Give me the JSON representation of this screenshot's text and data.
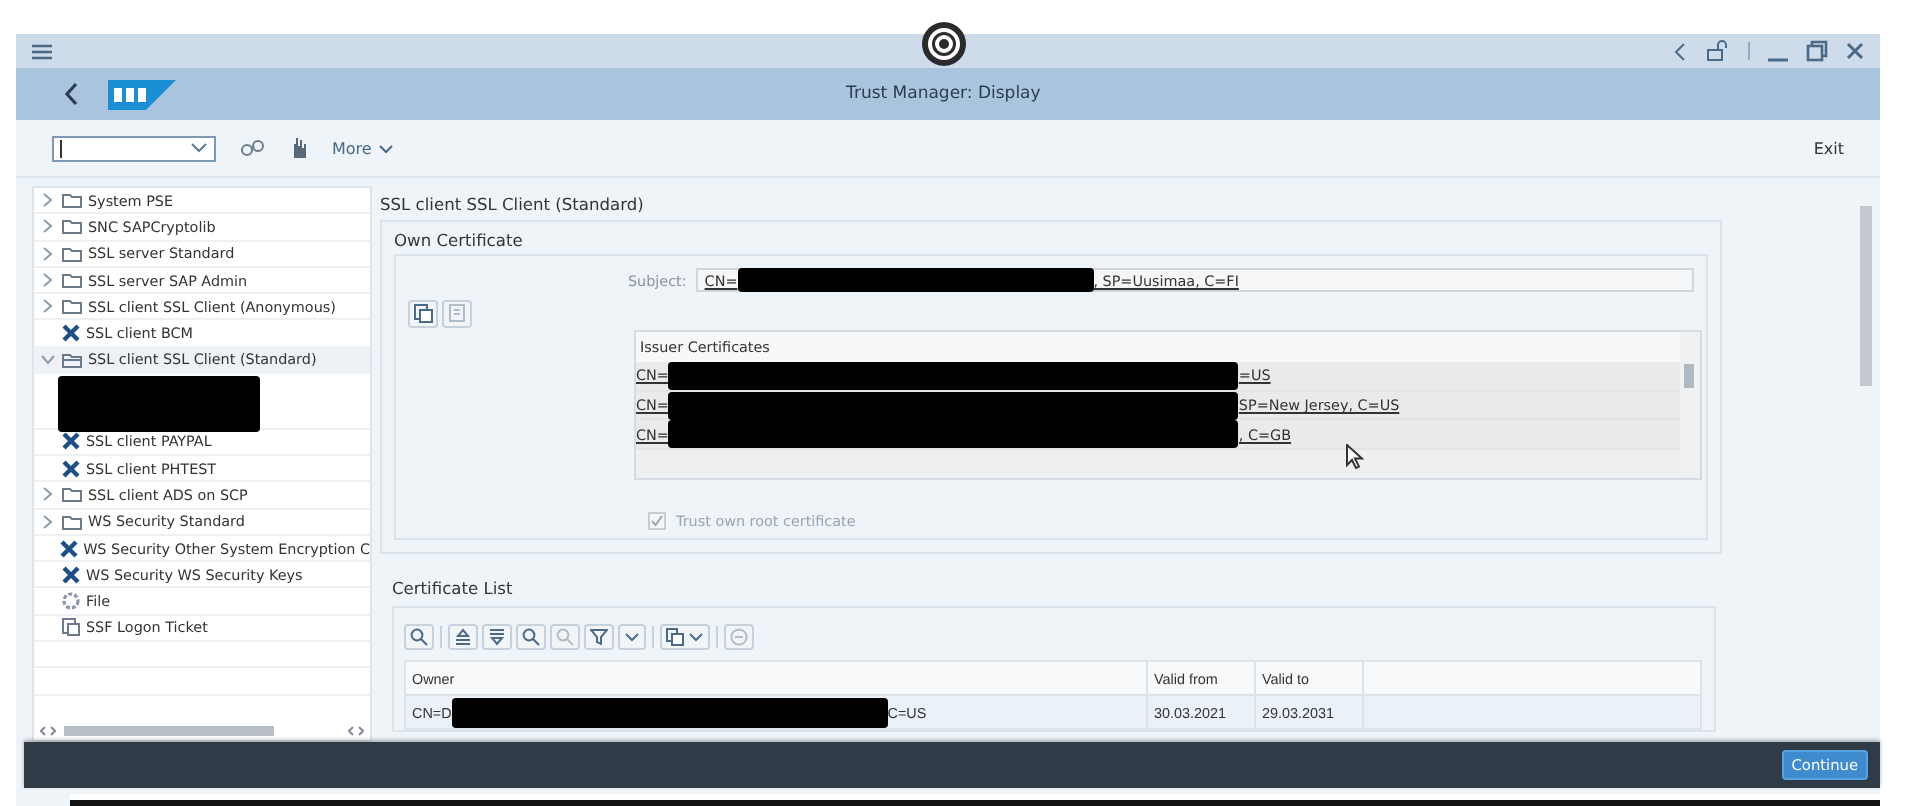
{
  "window": {
    "title": "Trust Manager: Display"
  },
  "toolbar": {
    "more": "More",
    "exit": "Exit"
  },
  "tree": [
    {
      "kind": "folder",
      "label": "System PSE",
      "expanded": false,
      "selected": false
    },
    {
      "kind": "folder",
      "label": "SNC SAPCryptolib",
      "expanded": false,
      "selected": false
    },
    {
      "kind": "folder",
      "label": "SSL server Standard",
      "expanded": false,
      "selected": false
    },
    {
      "kind": "folder",
      "label": "SSL server SAP Admin",
      "expanded": false,
      "selected": false
    },
    {
      "kind": "folder",
      "label": "SSL client SSL Client (Anonymous)",
      "expanded": false,
      "selected": false
    },
    {
      "kind": "missing",
      "label": "SSL client BCM",
      "selected": false
    },
    {
      "kind": "folder",
      "label": "SSL client SSL Client (Standard)",
      "expanded": true,
      "selected": true
    },
    {
      "kind": "redacted"
    },
    {
      "kind": "missing",
      "label": "SSL client PAYPAL",
      "selected": false
    },
    {
      "kind": "missing",
      "label": "SSL client PHTEST",
      "selected": false
    },
    {
      "kind": "folder",
      "label": "SSL client ADS on SCP",
      "expanded": false,
      "selected": false
    },
    {
      "kind": "folder",
      "label": "WS Security Standard",
      "expanded": false,
      "selected": false
    },
    {
      "kind": "missing",
      "label": "WS Security Other System Encryption C",
      "selected": false
    },
    {
      "kind": "missing",
      "label": "WS Security WS Security Keys",
      "selected": false
    },
    {
      "kind": "file",
      "label": "File",
      "selected": false
    },
    {
      "kind": "ticket",
      "label": "SSF Logon Ticket",
      "selected": false
    }
  ],
  "detail": {
    "heading": "SSL client SSL Client (Standard)",
    "own_certificate": {
      "title": "Own Certificate",
      "subject_label": "Subject:",
      "subject_start": "CN=",
      "subject_end": ", SP=Uusimaa, C=FI",
      "issuer_title": "Issuer Certificates",
      "issuers": [
        {
          "start": "CN=",
          "end": "=US"
        },
        {
          "start": "CN=",
          "end": "SP=New Jersey, C=US"
        },
        {
          "start": "CN=",
          "end": ", C=GB"
        }
      ],
      "trust_root": {
        "label": "Trust own root certificate",
        "checked": true,
        "disabled": true
      }
    },
    "certificate_list": {
      "title": "Certificate List",
      "columns": [
        "Owner",
        "Valid from",
        "Valid to"
      ],
      "rows": [
        {
          "owner_start": "CN=D",
          "owner_end": "C=US",
          "valid_from": "30.03.2021",
          "valid_to": "29.03.2031"
        }
      ]
    }
  },
  "footer": {
    "button": "Continue"
  }
}
